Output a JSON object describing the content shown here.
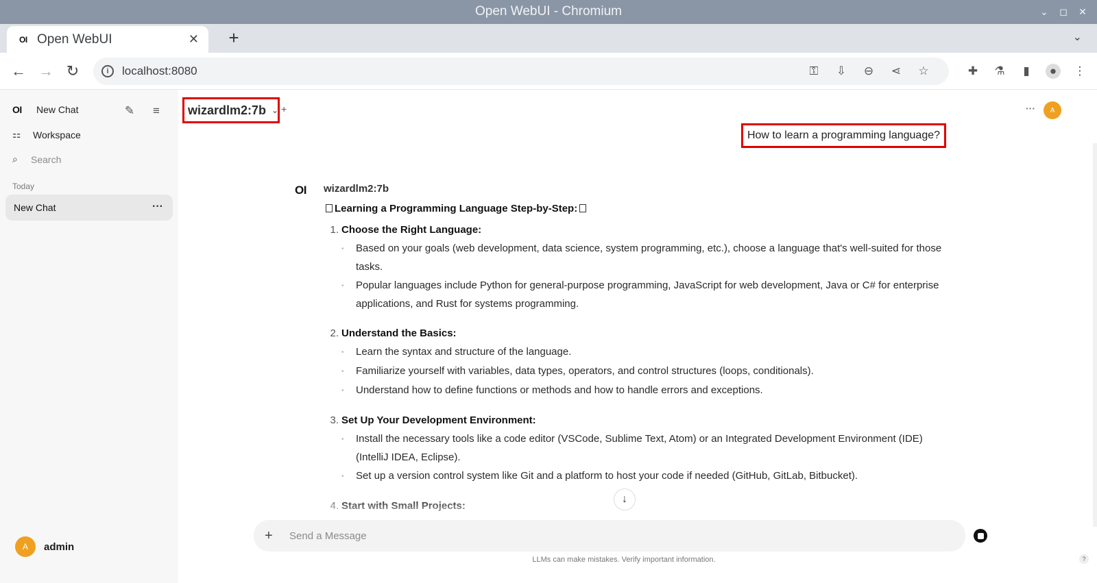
{
  "window": {
    "title": "Open WebUI - Chromium"
  },
  "browser": {
    "tab_title": "Open WebUI",
    "tab_favicon": "OI",
    "url": "localhost:8080"
  },
  "sidebar": {
    "logo": "OI",
    "new_chat": "New Chat",
    "workspace": "Workspace",
    "search_placeholder": "Search",
    "section_today": "Today",
    "chats": [
      {
        "title": "New Chat"
      }
    ],
    "user": {
      "initial": "A",
      "name": "admin"
    }
  },
  "header": {
    "model": "wizardlm2:7b",
    "avatar_initial": "A"
  },
  "conversation": {
    "user_message": "How to learn a programming language?",
    "assistant_logo": "OI",
    "assistant_name": "wizardlm2:7b",
    "response_title": "Learning a Programming Language Step-by-Step:",
    "steps": [
      {
        "num": "1.",
        "title": "Choose the Right Language:",
        "bullets": [
          "Based on your goals (web development, data science, system programming, etc.), choose a language that's well-suited for those tasks.",
          "Popular languages include Python for general-purpose programming, JavaScript for web development, Java or C# for enterprise applications, and Rust for systems programming."
        ]
      },
      {
        "num": "2.",
        "title": "Understand the Basics:",
        "bullets": [
          "Learn the syntax and structure of the language.",
          "Familiarize yourself with variables, data types, operators, and control structures (loops, conditionals).",
          "Understand how to define functions or methods and how to handle errors and exceptions."
        ]
      },
      {
        "num": "3.",
        "title": "Set Up Your Development Environment:",
        "bullets": [
          "Install the necessary tools like a code editor (VSCode, Sublime Text, Atom) or an Integrated Development Environment (IDE) (IntelliJ IDEA, Eclipse).",
          "Set up a version control system like Git and a platform to host your code if needed (GitHub, GitLab, Bitbucket)."
        ]
      },
      {
        "num": "4.",
        "title": "Start with Small Projects:",
        "bullets": []
      }
    ]
  },
  "composer": {
    "placeholder": "Send a Message",
    "disclaimer": "LLMs can make mistakes. Verify important information.",
    "help": "?"
  }
}
